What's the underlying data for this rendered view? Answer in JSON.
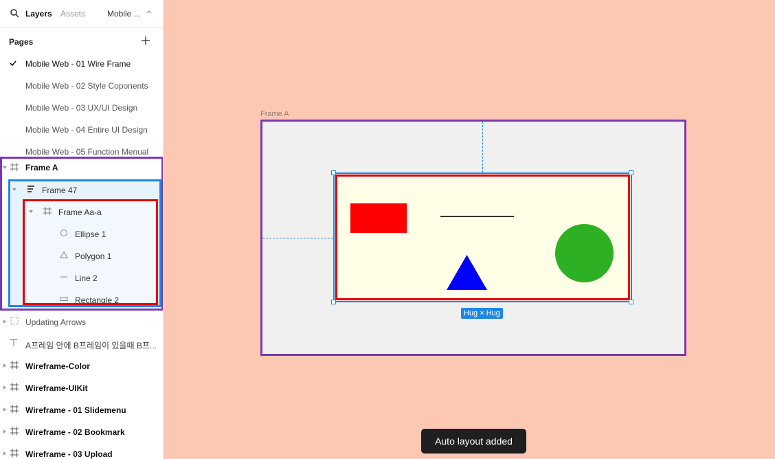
{
  "topbar": {
    "tab_layers": "Layers",
    "tab_assets": "Assets",
    "page_select": "Mobile ..."
  },
  "pages": {
    "header": "Pages",
    "items": [
      "Mobile Web - 01 Wire Frame",
      "Mobile Web - 02 Style Coponents",
      "Mobile Web - 03 UX/UI Design",
      "Mobile Web - 04 Entire UI Design",
      "Mobile Web - 05 Function Menual"
    ]
  },
  "layers": {
    "frame_a": "Frame A",
    "frame_47": "Frame 47",
    "frame_aa": "Frame Aa-a",
    "ellipse": "Ellipse 1",
    "polygon": "Polygon 1",
    "line": "Line 2",
    "rectangle": "Rectangle 2",
    "updating_arrows": "Updating Arrows",
    "text_layer": "A프레임 안에 B프레임이 있을때 B프...",
    "wf_color": "Wireframe-Color",
    "wf_uikit": "Wireframe-UIKit",
    "wf_slidemenu": "Wireframe - 01 Slidemenu",
    "wf_bookmark": "Wireframe - 02 Bookmark",
    "wf_upload": "Wireframe - 03 Upload"
  },
  "canvas": {
    "frame_label": "Frame A",
    "hug_label": "Hug × Hug",
    "colors": {
      "frame_a_border": "#7b3aad",
      "selection": "#1e88e5",
      "rect": "#ff0000",
      "ellipse": "#2db024",
      "polygon": "#0000ff",
      "frame_aa_fill": "#fffee6"
    }
  },
  "toast": "Auto layout added"
}
